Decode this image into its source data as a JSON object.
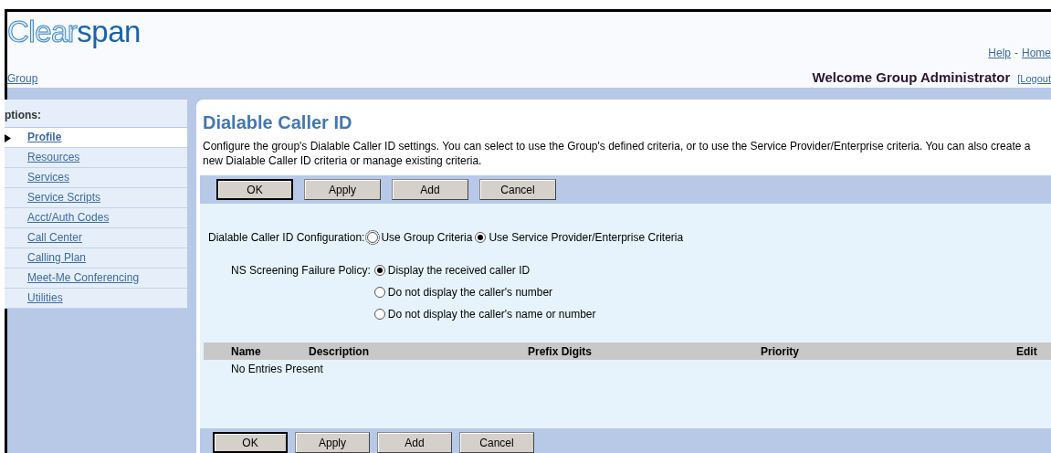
{
  "header": {
    "logo_light": "Clear",
    "logo_dark": "span",
    "links": [
      "Help",
      "Home"
    ],
    "link_separator": "-",
    "breadcrumb": "Group",
    "welcome": "Welcome Group Administrator",
    "logout": "[Logout"
  },
  "sidebar": {
    "title": "ptions:",
    "items": [
      {
        "label": "Profile",
        "selected": true
      },
      {
        "label": "Resources",
        "selected": false
      },
      {
        "label": "Services",
        "selected": false
      },
      {
        "label": "Service Scripts",
        "selected": false
      },
      {
        "label": "Acct/Auth Codes",
        "selected": false
      },
      {
        "label": "Call Center",
        "selected": false
      },
      {
        "label": "Calling Plan",
        "selected": false
      },
      {
        "label": "Meet-Me Conferencing",
        "selected": false
      },
      {
        "label": "Utilities",
        "selected": false
      }
    ]
  },
  "page": {
    "title": "Dialable Caller ID",
    "description": "Configure the group's Dialable Caller ID settings. You can select to use the Group's defined criteria, or to use the Service Provider/Enterprise criteria. You can also create a new Dialable Caller ID criteria or manage existing criteria.",
    "buttons_top": [
      "OK",
      "Apply",
      "Add",
      "Cancel"
    ],
    "configuration": {
      "label": "Dialable Caller ID Configuration:",
      "options": [
        {
          "label": "Use Group Criteria",
          "selected": false
        },
        {
          "label": "Use Service Provider/Enterprise Criteria",
          "selected": true
        }
      ]
    },
    "policy": {
      "label": "NS Screening Failure Policy:",
      "options": [
        {
          "label": "Display the received caller ID",
          "selected": true
        },
        {
          "label": "Do not display the caller's number",
          "selected": false
        },
        {
          "label": "Do not display the caller's name or number",
          "selected": false
        }
      ]
    },
    "table": {
      "columns": [
        "Name",
        "Description",
        "Prefix Digits",
        "Priority",
        "Edit"
      ],
      "empty": "No Entries Present"
    },
    "buttons_bottom": [
      "OK",
      "Apply",
      "Add",
      "Cancel"
    ]
  }
}
